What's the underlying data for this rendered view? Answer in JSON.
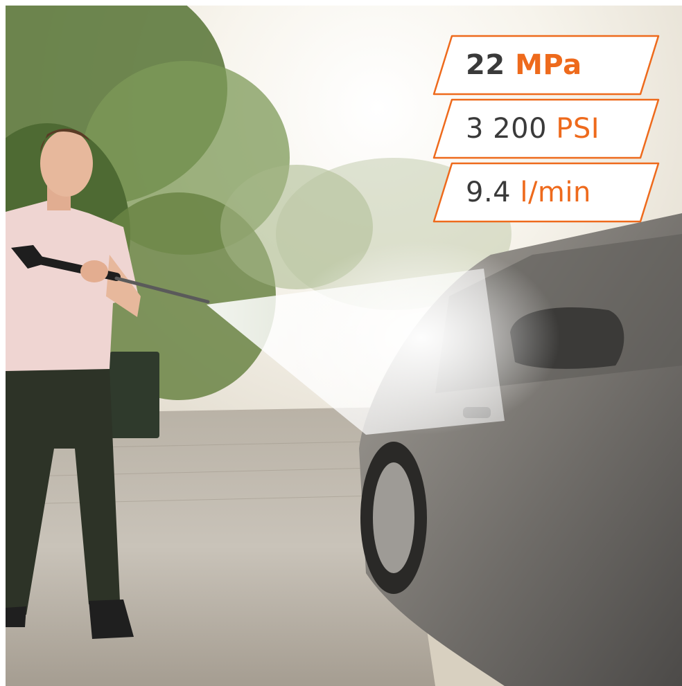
{
  "specs": [
    {
      "value": "22",
      "unit": "MPa",
      "bold": true
    },
    {
      "value": "3 200",
      "unit": "PSI",
      "bold": false
    },
    {
      "value": "9.4",
      "unit": "l/min",
      "bold": false
    }
  ],
  "colors": {
    "accent": "#ee6a1c",
    "badge_fill": "#ffffff",
    "number_text": "#3a3a3a"
  },
  "scene": {
    "subjects": [
      "man-with-pressure-washer",
      "gray-car",
      "water-spray",
      "trees",
      "paved-driveway"
    ]
  }
}
